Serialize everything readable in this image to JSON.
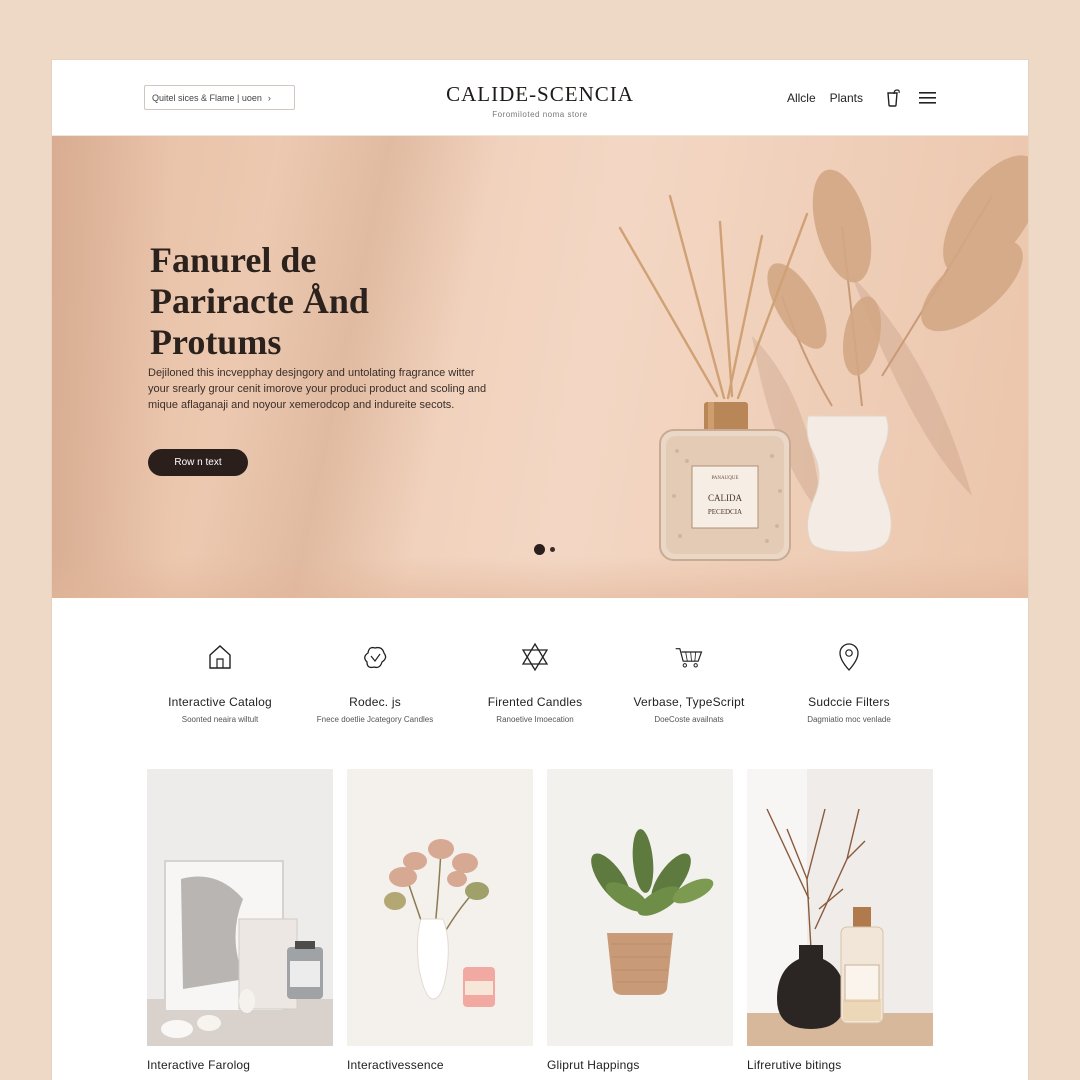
{
  "header": {
    "search_label": "Quitel sices & Flame | uoen",
    "search_chevron": "›",
    "brand_title": "CALIDE-SCENCIA",
    "brand_subtitle": "Foromiloted noma store",
    "nav": [
      "Allcle",
      "Plants"
    ],
    "icons": [
      "shopping-bag-icon",
      "hamburger-menu-icon"
    ]
  },
  "hero": {
    "title_lines": [
      "Fanurel de",
      "Pariracte Ånd",
      "Protums"
    ],
    "description": "Dejiloned this incvepphay desjngory and untolating fragrance witter your srearly grour cenit imorove your produci product and scoling and mique aflaganaji and noyour xemerodcop and indureite secots.",
    "button_label": "Row n text",
    "jar_label_top": "PANAUQUE",
    "jar_label_line1": "CALIDA",
    "jar_label_line2": "PECEDCIA",
    "colors": {
      "background": "#efcdb6",
      "button": "#2b1f1c"
    },
    "carousel": {
      "slides": 2,
      "active": 1
    }
  },
  "features": [
    {
      "icon": "home-icon",
      "title": "Interactive Catalog",
      "subtitle": "Soonted neaira wiltult"
    },
    {
      "icon": "flower-icon",
      "title": "Rodec. js",
      "subtitle": "Fnece doetlie Jcategory Candles"
    },
    {
      "icon": "star-of-david-icon",
      "title": "Firented Candles",
      "subtitle": "Ranoetive Imoecation"
    },
    {
      "icon": "shopping-cart-icon",
      "title": "Verbase, TypeScript",
      "subtitle": "DoeCoste availnats"
    },
    {
      "icon": "location-pin-icon",
      "title": "Sudccie Filters",
      "subtitle": "Dagmiatio moc venlade"
    }
  ],
  "products": [
    {
      "name": "Interactive Farolog"
    },
    {
      "name": "Interactivessence"
    },
    {
      "name": "Gliprut Happings"
    },
    {
      "name": "Lifrerutive bitings"
    }
  ]
}
